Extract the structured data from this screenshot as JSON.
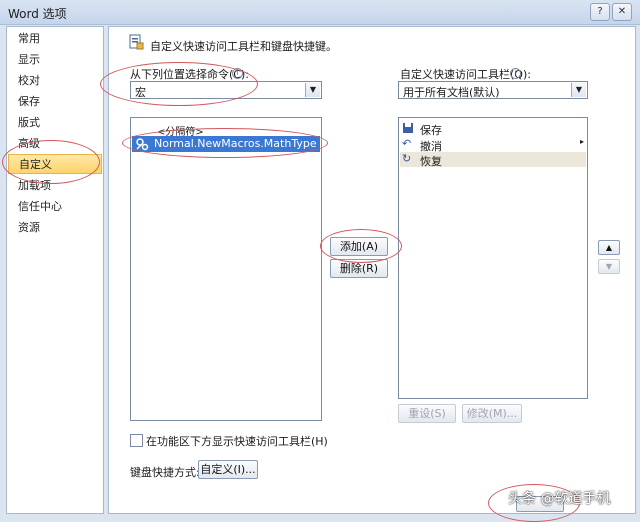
{
  "window": {
    "title": "Word 选项",
    "help_label": "?",
    "close_label": "✕"
  },
  "nav": {
    "items": [
      {
        "label": "常用"
      },
      {
        "label": "显示"
      },
      {
        "label": "校对"
      },
      {
        "label": "保存"
      },
      {
        "label": "版式"
      },
      {
        "label": "高级"
      },
      {
        "label": "自定义"
      },
      {
        "label": "加载项"
      },
      {
        "label": "信任中心"
      },
      {
        "label": "资源"
      }
    ],
    "active_index": 6
  },
  "header": {
    "text": "自定义快速访问工具栏和键盘快捷键。"
  },
  "left": {
    "choose_label": "从下列位置选择命令(C):",
    "choose_value": "宏",
    "list_items": [
      {
        "label": "<分隔符>"
      },
      {
        "label": "Normal.NewMacros.MathType"
      }
    ]
  },
  "right": {
    "toolbar_label": "自定义快速访问工具栏(Q):",
    "toolbar_value": "用于所有文档(默认)",
    "list_items": [
      {
        "label": "保存",
        "icon": "save-icon"
      },
      {
        "label": "撤消",
        "icon": "undo-icon"
      },
      {
        "label": "恢复",
        "icon": "redo-icon"
      }
    ]
  },
  "buttons": {
    "add": "添加(A) >>",
    "remove": "删除(R)",
    "reset": "重设(S)",
    "modify": "修改(M)...",
    "move_up": "▲",
    "move_down": "▼",
    "customize": "自定义(I)..."
  },
  "checkbox": {
    "label": "在功能区下方显示快速访问工具栏(H)",
    "checked": false
  },
  "keyboard": {
    "label": "键盘快捷方式:"
  },
  "watermark": {
    "text": "头条 @软道手机"
  },
  "colors": {
    "highlight": "#3a78d4",
    "annotation": "#d2585d"
  }
}
